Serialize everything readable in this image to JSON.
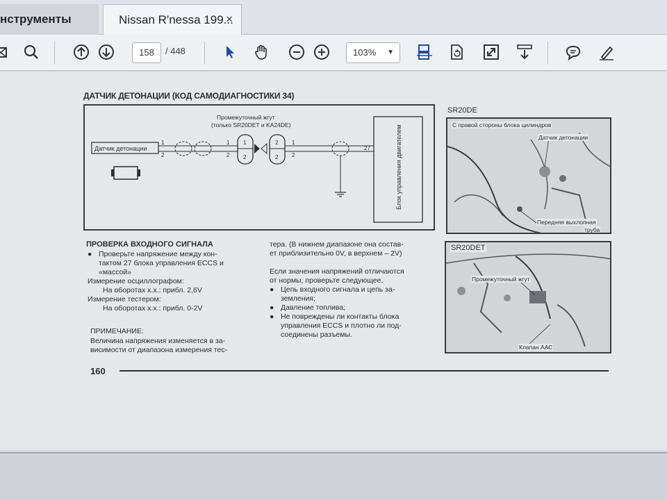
{
  "tabs": {
    "tools_label": "нструменты",
    "doc_label": "Nissan R'nessa 199...",
    "close_glyph": "×"
  },
  "toolbar": {
    "page_current": "158",
    "page_sep_total": "/ 448",
    "zoom": "103%",
    "icons": [
      "print-icon",
      "search-icon",
      "page-up-icon",
      "page-down-icon",
      "select-cursor-icon",
      "hand-tool-icon",
      "zoom-out-icon",
      "zoom-in-icon",
      "fit-page-icon",
      "rotate-icon",
      "fullscreen-icon",
      "read-mode-icon",
      "comment-icon",
      "sign-icon"
    ],
    "accent": "#1b4f9c"
  },
  "page": {
    "section_title": "ДАТЧИК ДЕТОНАЦИИ (КОД САМОДИАГНОСТИКИ 34)",
    "diagram": {
      "harness_label_1": "Промежуточный жгут",
      "harness_label_2": "(только SR20DET и KA24DE)",
      "sensor_label": "Датчик детонации",
      "ecu_label": "Блок управления двигателем",
      "pin_27": "27",
      "pin_1a": "1",
      "pin_2a": "2",
      "pin_1b": "1",
      "pin_2b": "2",
      "pin_1c": "1",
      "pin_2c": "2",
      "conn_1": "1",
      "conn_2": "2",
      "conn_3": "2",
      "conn_4": "2"
    },
    "check_title": "ПРОВЕРКА ВХОДНОГО СИГНАЛА",
    "col1": {
      "b1_l1": "Проверьте напряжение между кон-",
      "b1_l2": "тактом 27 блока управления ECCS и",
      "b1_l3": "«массой»",
      "osc": "Измерение осциллографом:",
      "osc_val": "На оборотах х.х.: прибл. 2,6V",
      "tester": "Измерение тестером:",
      "tester_val": "На оборотах х.х.: прибл. 0-2V"
    },
    "note_title": "ПРИМЕЧАНИЕ:",
    "note_l1": "Величина напряжения изменяется в за-",
    "note_l2": "висимости от диапазона измерения тес-",
    "col2": {
      "l1": "тера. (В нижнем диапазоне она состав-",
      "l2": "ет приблизительно 0V, в верхнем – 2V)",
      "l3": "Если значения напряжений отличаются",
      "l4": "от нормы, проверьте следующее.",
      "b1_l1": "Цепь входного сигнала и цепь за-",
      "b1_l2": "земления;",
      "b2_l1": "Давление топлива;",
      "b3_l1": "Не повреждены ли контакты блока",
      "b3_l2": "управления ECCS и плотно ли под-",
      "b3_l3": "соединены разъемы."
    },
    "page_number": "160",
    "photo1": {
      "title": "SR20DE",
      "l1": "С правой стороны блока цилиндров",
      "l2": "Датчик детонации",
      "l3": "Передняя выхлопная",
      "l4": "труба"
    },
    "photo2": {
      "title": "SR20DET",
      "l1": "Промежуточный жгут",
      "l2": "Клапан ААС"
    }
  }
}
